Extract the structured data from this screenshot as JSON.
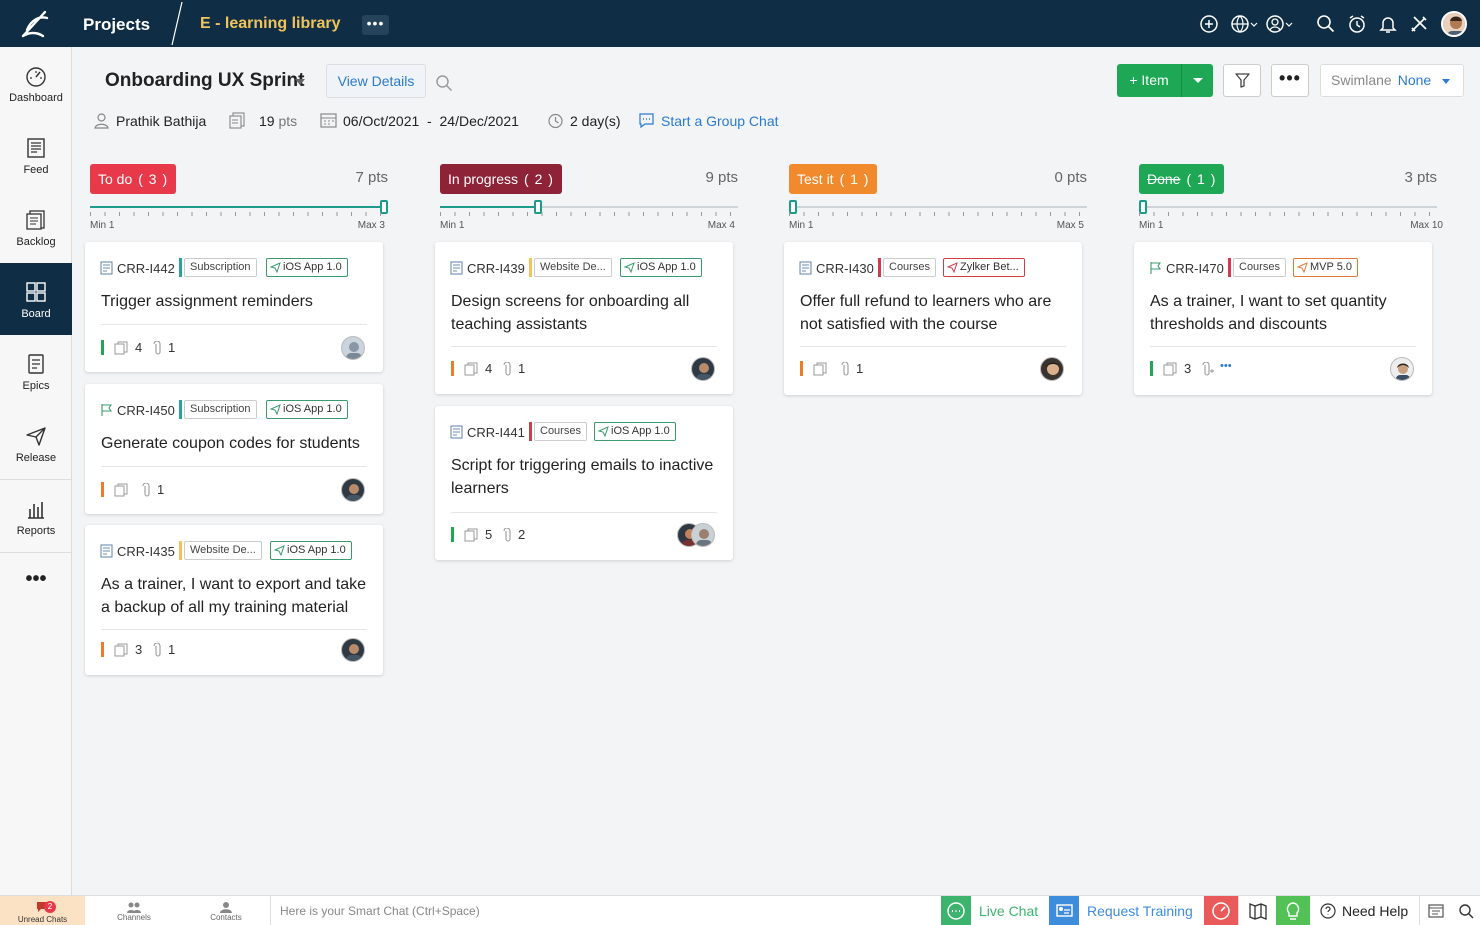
{
  "topbar": {
    "section": "Projects",
    "project_name": "E - learning library",
    "more_label": "•••",
    "icons": [
      "add-icon",
      "globe-icon",
      "user-circle-icon",
      "search-icon",
      "timer-icon",
      "bell-icon",
      "tools-icon",
      "avatar"
    ]
  },
  "sidebar": {
    "items": [
      {
        "label": "Dashboard",
        "icon": "dashboard-icon"
      },
      {
        "label": "Feed",
        "icon": "feed-icon"
      },
      {
        "label": "Backlog",
        "icon": "backlog-icon"
      },
      {
        "label": "Board",
        "icon": "board-icon",
        "active": true
      },
      {
        "label": "Epics",
        "icon": "epics-icon"
      },
      {
        "label": "Release",
        "icon": "release-icon"
      },
      {
        "label": "Reports",
        "icon": "reports-icon"
      }
    ],
    "more_label": "•••"
  },
  "header": {
    "sprint_title": "Onboarding UX Sprint",
    "view_details": "View Details",
    "add_item": "+ Item",
    "more_label": "•••",
    "swimlane_label": "Swimlane",
    "swimlane_value": "None"
  },
  "meta": {
    "owner": "Prathik Bathija",
    "points": "19",
    "points_unit": "pts",
    "dates": "06/Oct/2021  -  24/Dec/2021",
    "duration": "2 day(s)",
    "group_chat": "Start a Group Chat"
  },
  "columns": [
    {
      "name": "To do",
      "count": "( 3 )",
      "pts": "7 pts",
      "color": "#e8394a",
      "min": "Min 1",
      "max": "Max 3",
      "fill": 1.0,
      "cards": [
        {
          "id": "CRR-I442",
          "module": "Subscription",
          "release": "iOS App 1.0",
          "title": "Trigger assignment reminders",
          "priority": "#1ea855",
          "sub": "4",
          "att": "1"
        },
        {
          "id": "CRR-I450",
          "module": "Subscription",
          "release": "iOS App 1.0",
          "title": "Generate coupon codes for students",
          "priority": "#f07a2b",
          "sub": "",
          "att": "1"
        },
        {
          "id": "CRR-I435",
          "module": "Website De...",
          "release": "iOS App 1.0",
          "title": "As a trainer, I want to export and take a backup of all my training material",
          "priority": "#f07a2b",
          "sub": "3",
          "att": "1"
        }
      ]
    },
    {
      "name": "In progress",
      "count": "( 2 )",
      "pts": "9 pts",
      "color": "#8e2237",
      "min": "Min 1",
      "max": "Max 4",
      "fill": 0.34,
      "cards": [
        {
          "id": "CRR-I439",
          "module": "Website De...",
          "release": "iOS App 1.0",
          "title": "Design screens for onboarding all teaching assistants",
          "priority": "#f07a2b",
          "sub": "4",
          "att": "1"
        },
        {
          "id": "CRR-I441",
          "module": "Courses",
          "release": "iOS App 1.0",
          "title": "Script for triggering emails to inactive learners",
          "priority": "#1ea855",
          "sub": "5",
          "att": "2"
        }
      ]
    },
    {
      "name": "Test it",
      "count": "( 1 )",
      "pts": "0 pts",
      "color": "#f08a2c",
      "min": "Min 1",
      "max": "Max 5",
      "fill": 0.0,
      "cards": [
        {
          "id": "CRR-I430",
          "module": "Courses",
          "release": "Zylker Bet...",
          "title": "Offer full refund to learners who are not satisfied with the course",
          "priority": "#f07a2b",
          "sub": "",
          "att": "1"
        }
      ]
    },
    {
      "name": "Done",
      "count": "( 1 )",
      "pts": "3 pts",
      "color": "#1ea855",
      "min": "Min 1",
      "max": "Max 10",
      "fill": 0.0,
      "cards": [
        {
          "id": "CRR-I470",
          "module": "Courses",
          "release": "MVP 5.0",
          "title": "As a trainer, I want to set quantity thresholds and discounts",
          "priority": "#1ea855",
          "sub": "3",
          "att": "",
          "more": "•••"
        }
      ]
    }
  ],
  "bottombar": {
    "unread_badge": "2",
    "unread_label": "Unread Chats",
    "channels": "Channels",
    "contacts": "Contacts",
    "smartchat_placeholder": "Here is your Smart Chat (Ctrl+Space)",
    "live_chat": "Live Chat",
    "request_training": "Request Training",
    "need_help": "Need Help"
  }
}
